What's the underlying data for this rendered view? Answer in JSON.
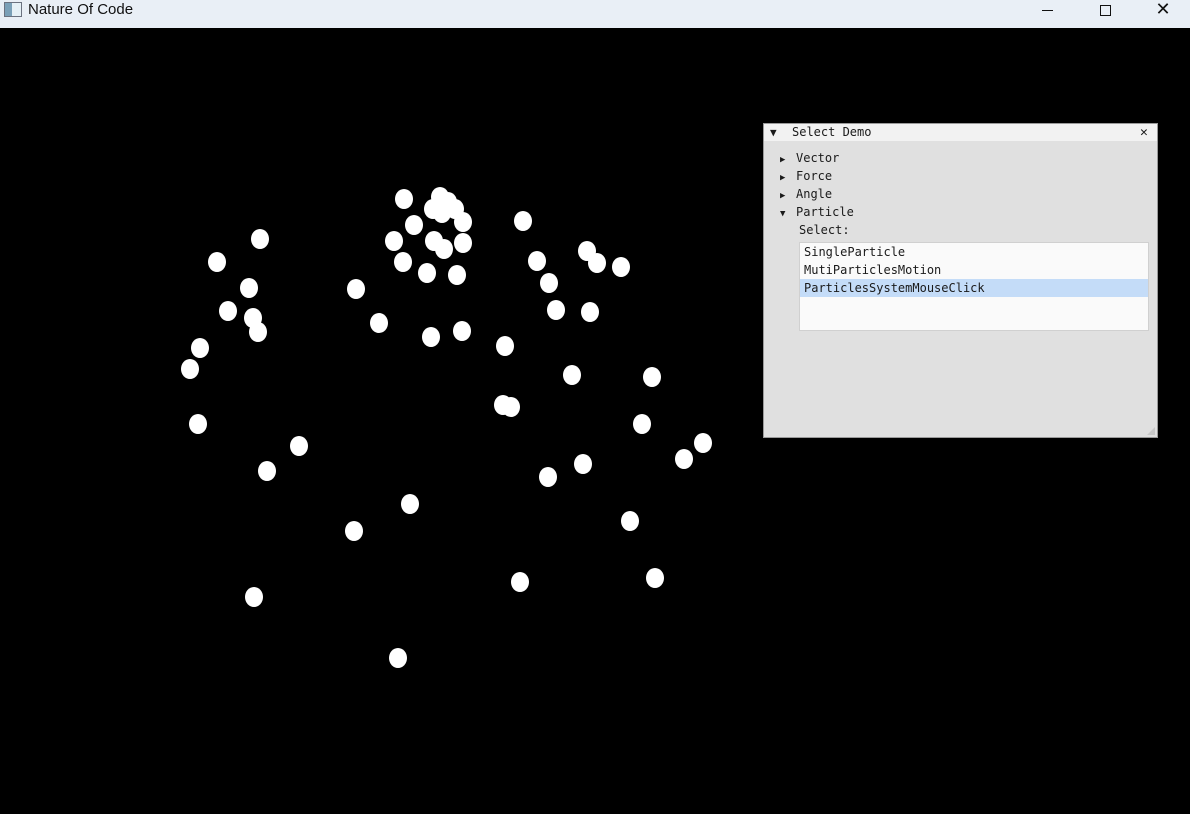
{
  "window": {
    "title": "Nature Of Code",
    "minimize_icon": "minimize-icon",
    "maximize_icon": "maximize-icon",
    "close_glyph": "✕"
  },
  "canvas": {
    "background": "#000000",
    "particle_color": "#ffffff"
  },
  "demo_panel": {
    "title": "Select Demo",
    "collapse_glyph": "▼",
    "close_glyph": "✕",
    "tree": [
      {
        "label": "Vector",
        "arrow": "▶"
      },
      {
        "label": "Force",
        "arrow": "▶"
      },
      {
        "label": "Angle",
        "arrow": "▶"
      },
      {
        "label": "Particle",
        "arrow": "▼"
      }
    ],
    "select_label": "Select:",
    "options": [
      "SingleParticle",
      "MutiParticlesMotion",
      "ParticlesSystemMouseClick"
    ],
    "selected_option": "ParticlesSystemMouseClick",
    "selected_color": "#c4dcf8"
  }
}
